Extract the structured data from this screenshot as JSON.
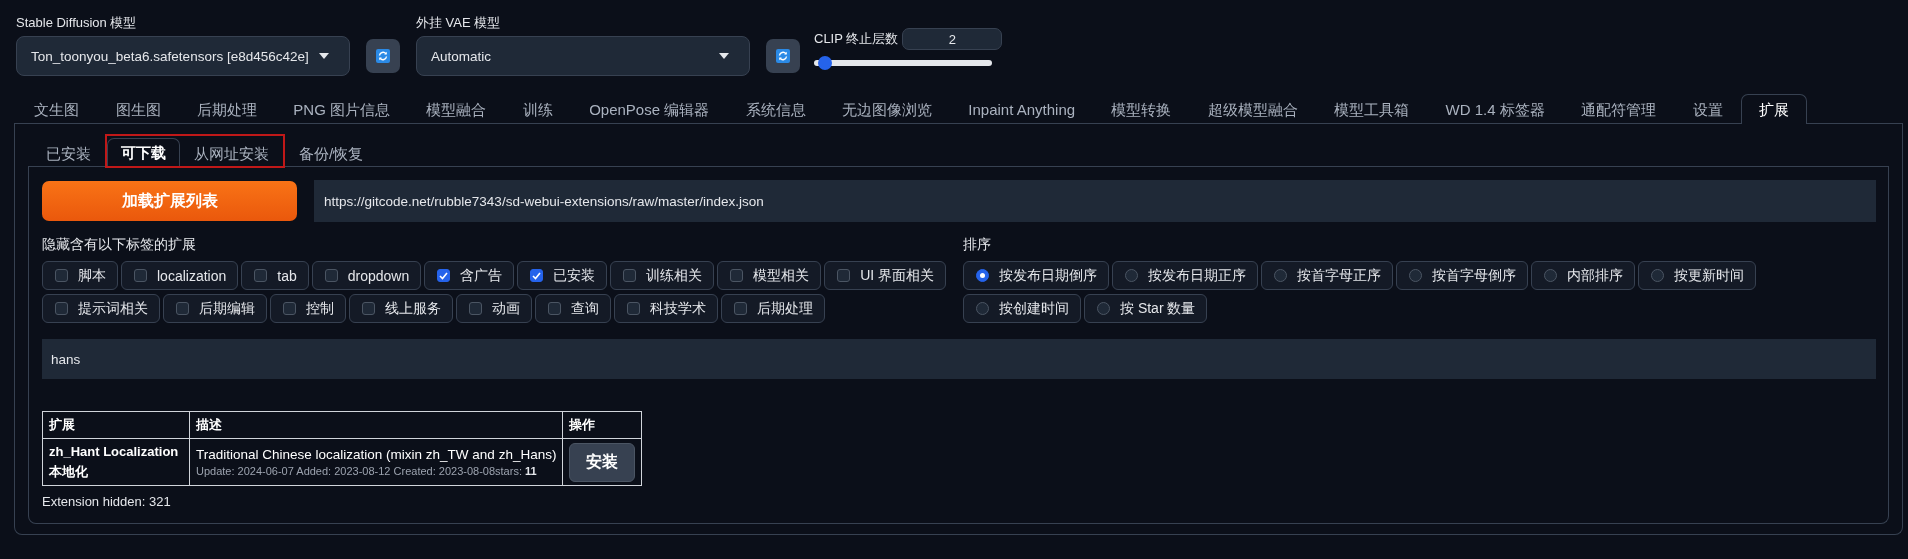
{
  "model_selectors": [
    {
      "label": "Stable Diffusion 模型",
      "value": "Ton_toonyou_beta6.safetensors [e8d456c42e]"
    },
    {
      "label": "外挂 VAE 模型",
      "value": "Automatic"
    }
  ],
  "clip_skip": {
    "label": "CLIP 终止层数",
    "value": "2",
    "level": 0.06
  },
  "main_tabs": [
    {
      "label": "文生图",
      "selected": false
    },
    {
      "label": "图生图",
      "selected": false
    },
    {
      "label": "后期处理",
      "selected": false
    },
    {
      "label": "PNG 图片信息",
      "selected": false
    },
    {
      "label": "模型融合",
      "selected": false
    },
    {
      "label": "训练",
      "selected": false
    },
    {
      "label": "OpenPose 编辑器",
      "selected": false
    },
    {
      "label": "系统信息",
      "selected": false
    },
    {
      "label": "无边图像浏览",
      "selected": false
    },
    {
      "label": "Inpaint Anything",
      "selected": false
    },
    {
      "label": "模型转换",
      "selected": false
    },
    {
      "label": "超级模型融合",
      "selected": false
    },
    {
      "label": "模型工具箱",
      "selected": false
    },
    {
      "label": "WD 1.4 标签器",
      "selected": false
    },
    {
      "label": "通配符管理",
      "selected": false
    },
    {
      "label": "设置",
      "selected": false
    },
    {
      "label": "扩展",
      "selected": true
    }
  ],
  "sub_tabs": [
    {
      "label": "已安装",
      "selected": false,
      "boxed": false
    },
    {
      "label": "可下载",
      "selected": true,
      "boxed": true
    },
    {
      "label": "从网址安装",
      "selected": false,
      "boxed": true
    },
    {
      "label": "备份/恢复",
      "selected": false,
      "boxed": false
    }
  ],
  "load_button": "加载扩展列表",
  "index_url": "https://gitcode.net/rubble7343/sd-webui-extensions/raw/master/index.json",
  "hide_tags": {
    "label": "隐藏含有以下标签的扩展",
    "options": [
      {
        "label": "脚本",
        "checked": false
      },
      {
        "label": "localization",
        "checked": false
      },
      {
        "label": "tab",
        "checked": false
      },
      {
        "label": "dropdown",
        "checked": false
      },
      {
        "label": "含广告",
        "checked": true
      },
      {
        "label": "已安装",
        "checked": true
      },
      {
        "label": "训练相关",
        "checked": false
      },
      {
        "label": "模型相关",
        "checked": false
      },
      {
        "label": "UI 界面相关",
        "checked": false
      },
      {
        "label": "提示词相关",
        "checked": false
      },
      {
        "label": "后期编辑",
        "checked": false
      },
      {
        "label": "控制",
        "checked": false
      },
      {
        "label": "线上服务",
        "checked": false
      },
      {
        "label": "动画",
        "checked": false
      },
      {
        "label": "查询",
        "checked": false
      },
      {
        "label": "科技学术",
        "checked": false
      },
      {
        "label": "后期处理",
        "checked": false
      }
    ]
  },
  "sort": {
    "label": "排序",
    "options": [
      {
        "label": "按发布日期倒序",
        "selected": true
      },
      {
        "label": "按发布日期正序",
        "selected": false
      },
      {
        "label": "按首字母正序",
        "selected": false
      },
      {
        "label": "按首字母倒序",
        "selected": false
      },
      {
        "label": "内部排序",
        "selected": false
      },
      {
        "label": "按更新时间",
        "selected": false
      },
      {
        "label": "按创建时间",
        "selected": false
      },
      {
        "label": "按 Star 数量",
        "selected": false
      }
    ]
  },
  "search": {
    "value": "hans"
  },
  "table": {
    "columns": [
      "扩展",
      "描述",
      "操作"
    ],
    "rows": [
      {
        "name": "zh_Hant Localization 本地化",
        "description": "Traditional Chinese localization (mixin zh_TW and zh_Hans)",
        "meta": "Update: 2024-06-07 Added: 2023-08-12 Created: 2023-08-08stars: **11**",
        "action": "安装"
      }
    ]
  },
  "footer": "Extension hidden: 321"
}
